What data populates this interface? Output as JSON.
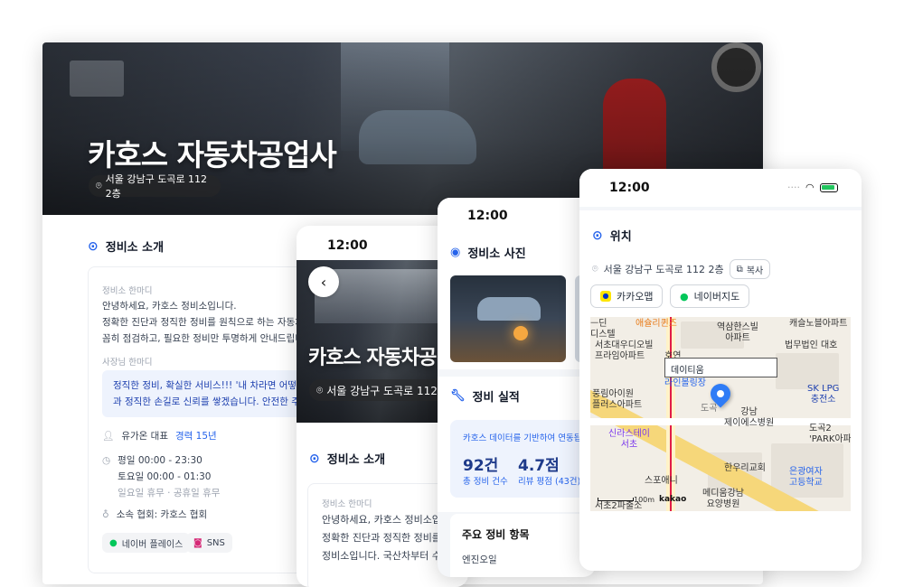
{
  "main": {
    "title": "카호스 자동차공업사",
    "address": "서울 강남구 도곡로 112 2층",
    "intro_title": "정비소 소개",
    "hanmadi_label": "정비소 한마디",
    "intro_text": "안녕하세요, 카호스 정비소입니다.\n정확한 진단과 정직한 정비를 원칙으로 하는 자동차 정\n꼼히 점검하고, 필요한 정비만 투명하게 안내드립니다",
    "owner_label": "사장님 한마디",
    "owner_quote": "정직한 정비, 확실한 서비스!!! '내 차라면 어떻게 정\n과 정직한 손길로 신뢰를 쌓겠습니다. 안전한 주행,",
    "rep_name": "유가온 대표",
    "career": "경력 15년",
    "hours_weekday": "평일 00:00 - 23:30",
    "hours_sat": "토요일 00:00 - 01:30",
    "holiday": "일요일 휴무 · 공휴일 휴무",
    "association": "소속 협회: 카호스 협회",
    "chip_naver": "네이버 플레이스",
    "chip_sns": "SNS"
  },
  "phone1": {
    "time": "12:00",
    "title": "카호스 자동차공",
    "address": "서울 강남구 도곡로 112 2",
    "intro_title": "정비소 소개",
    "hanmadi_label": "정비소 한마디",
    "intro_text": "안녕하세요, 카호스 정비소입\n정확한 진단과 정직한 정비를\n정비소입니다. 국산차부터 수"
  },
  "phone2": {
    "time": "12:00",
    "photos_title": "정비소 사진",
    "record_title": "정비 실적",
    "record_note": "카호스 데이터를 기반하여 연동됩",
    "count_value": "92건",
    "count_label": "총 정비 건수",
    "rating_value": "4.7점",
    "rating_label": "리뷰 평점 (43건)",
    "items_title": "주요 정비 항목",
    "item1": "엔진오일"
  },
  "phone3": {
    "time": "12:00",
    "location_title": "위치",
    "address": "서울 강남구 도곡로 112 2층",
    "copy_label": "복사",
    "kakao_map": "카카오맵",
    "naver_map": "네이버지도",
    "map": {
      "label_aesol": "애슐리퀸즈",
      "label_yeoksam": "역삼한스빌\n아파트",
      "label_castle": "캐슬노블아파트",
      "label_di": "ᅳ딘\n디스텔",
      "label_seocho": "서초대우디오빌\n프라임아파트",
      "label_law": "법무법인 대호",
      "label_hoyeon": "호연",
      "label_tooltip": "데이티움",
      "label_bowling": "라인볼링장",
      "label_pungrim": "풍림아이원\n플러스아파트",
      "label_gangnam": "강남\n제이에스병원",
      "label_sklpg": "SK LPG\n충전소",
      "label_dogok": "도곡2\n'PARK아파",
      "label_road": "도곡",
      "label_shilla": "신라스테이\n서초",
      "label_hanwoo": "한우리교회",
      "label_spoany": "스포애니",
      "label_medi": "메디움강남\n요양병원",
      "label_eunkwang": "은광여자\n고등학교",
      "label_scale": "100m",
      "label_kakao": "kakao",
      "label_seocho2": "서초2파출소"
    }
  },
  "colors": {
    "accent": "#2563eb",
    "kakao": "#fee500",
    "naver": "#03c75a",
    "pin": "#2f7cf6"
  }
}
